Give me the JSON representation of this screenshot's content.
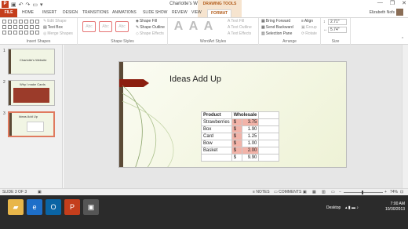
{
  "window": {
    "title": "Charlotte's Website - PowerPoint",
    "app_icon": "P",
    "minimize_glyph": "—",
    "restore_glyph": "❐",
    "close_glyph": "✕"
  },
  "context_tab_group": {
    "title": "DRAWING TOOLS"
  },
  "tabs": [
    {
      "label": "FILE"
    },
    {
      "label": "HOME"
    },
    {
      "label": "INSERT"
    },
    {
      "label": "DESIGN"
    },
    {
      "label": "TRANSITIONS"
    },
    {
      "label": "ANIMATIONS"
    },
    {
      "label": "SLIDE SHOW"
    },
    {
      "label": "REVIEW"
    },
    {
      "label": "VIEW"
    },
    {
      "label": "FORMAT"
    }
  ],
  "user": {
    "name": "Elizabeth Nofs"
  },
  "ribbon": {
    "insert_shapes": {
      "label": "Insert Shapes",
      "edit_shape": "Edit Shape",
      "text_box": "Text Box",
      "merge_shapes": "Merge Shapes"
    },
    "shape_styles": {
      "label": "Shape Styles",
      "style_sample": "Abc",
      "shape_fill": "Shape Fill",
      "shape_outline": "Shape Outline",
      "shape_effects": "Shape Effects"
    },
    "wordart_styles": {
      "label": "WordArt Styles",
      "sample": "A",
      "text_fill": "Text Fill",
      "text_outline": "Text Outline",
      "text_effects": "Text Effects"
    },
    "arrange": {
      "label": "Arrange",
      "bring_forward": "Bring Forward",
      "send_backward": "Send Backward",
      "selection_pane": "Selection Pane",
      "align": "Align",
      "group": "Group",
      "rotate": "Rotate"
    },
    "size": {
      "label": "Size",
      "height": "2.71\"",
      "width": "5.74\""
    }
  },
  "slides": [
    {
      "number": "1",
      "title": "Charlotte's Website"
    },
    {
      "number": "2",
      "title": "Why I make Cards"
    },
    {
      "number": "3",
      "title": "Ideas Add Up"
    }
  ],
  "slide": {
    "title": "Ideas Add Up",
    "table": {
      "headers": [
        "Product",
        "Wholesale"
      ],
      "rows": [
        {
          "product": "Strawberries",
          "currency": "$",
          "value": "3.75"
        },
        {
          "product": "Box",
          "currency": "$",
          "value": "1.90"
        },
        {
          "product": "Card",
          "currency": "$",
          "value": "1.25"
        },
        {
          "product": "Bow",
          "currency": "$",
          "value": "1.00"
        },
        {
          "product": "Basket",
          "currency": "$",
          "value": "2.00"
        }
      ],
      "total": {
        "currency": "$",
        "value": "9.90"
      }
    }
  },
  "status": {
    "slide_indicator": "SLIDE 3 OF 3",
    "notes": "NOTES",
    "comments": "COMMENTS",
    "zoom": "74%"
  },
  "taskbar": {
    "desktop": "Desktop",
    "time": "7:00 AM",
    "date": "10/30/2013"
  }
}
